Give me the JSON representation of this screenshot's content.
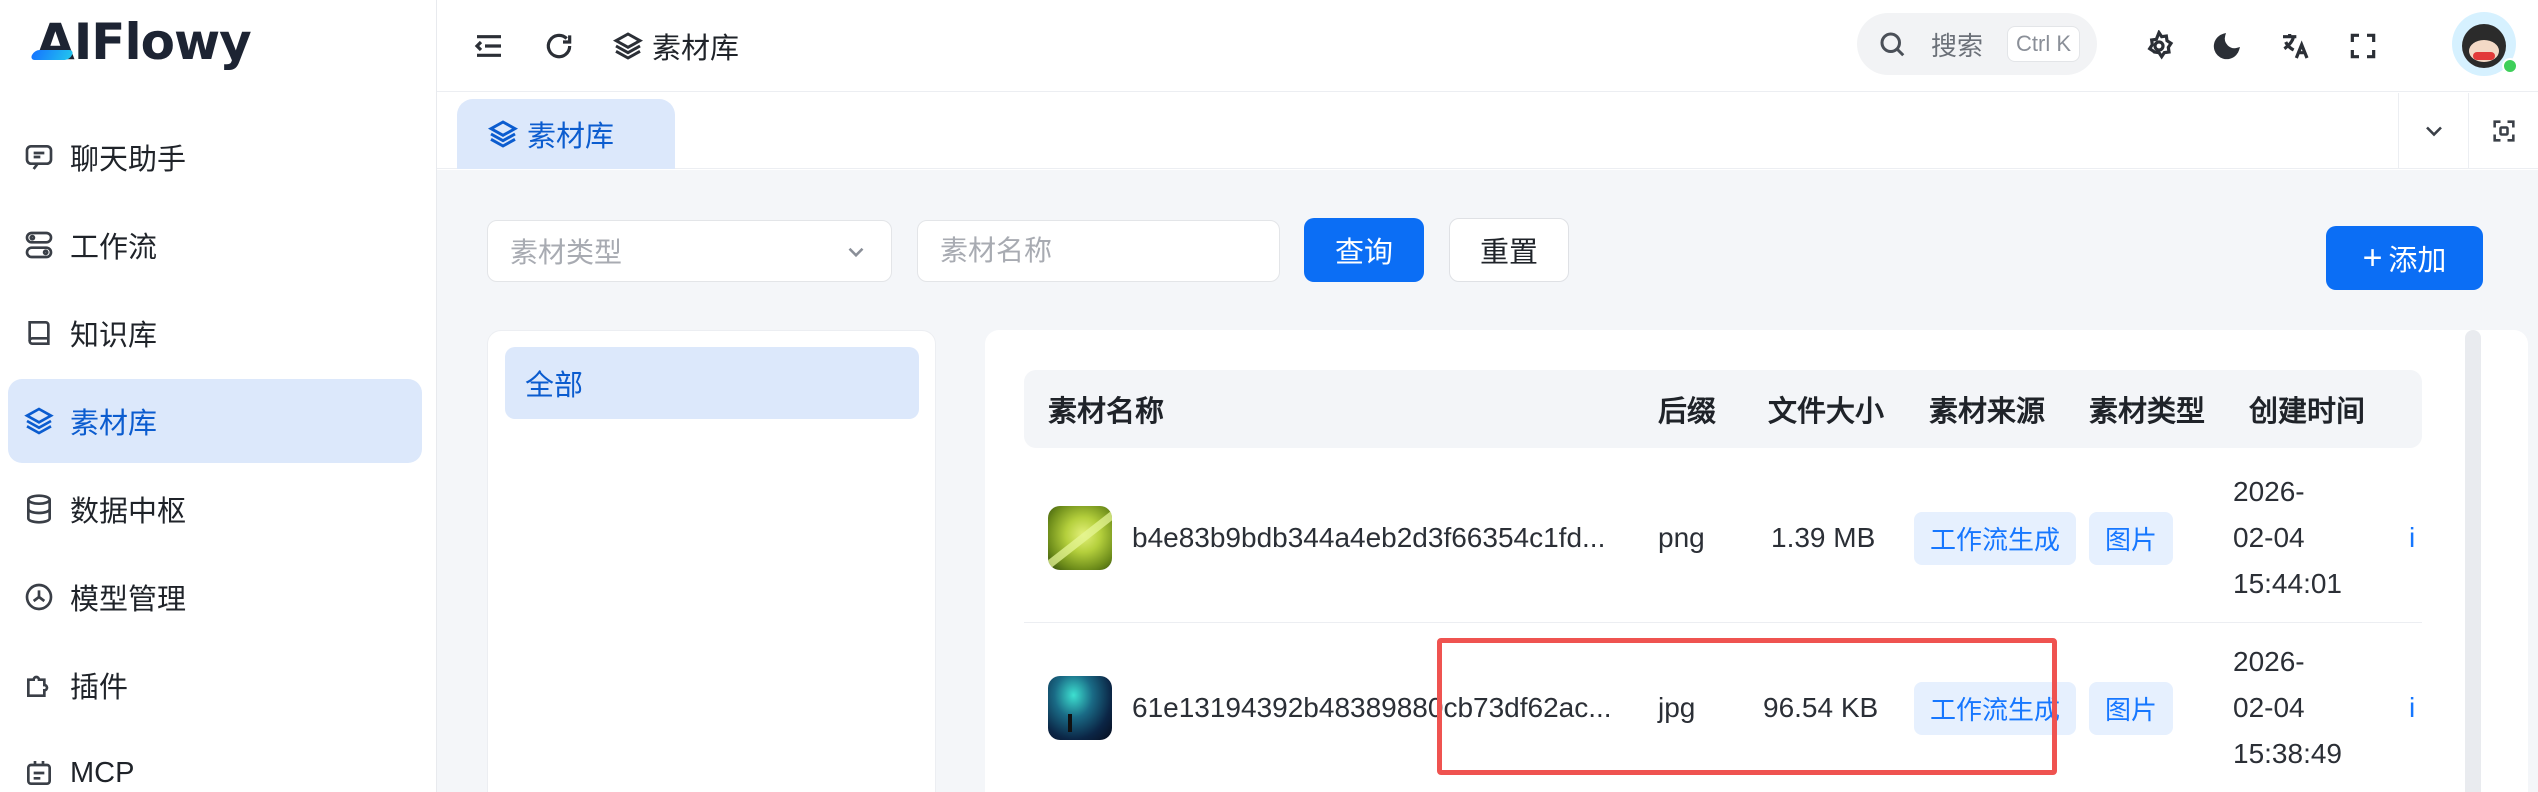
{
  "app": {
    "logo": "AIFlowy"
  },
  "sidebar": {
    "items": [
      {
        "label": "聊天助手",
        "icon": "chat-icon"
      },
      {
        "label": "工作流",
        "icon": "workflow-icon"
      },
      {
        "label": "知识库",
        "icon": "book-icon"
      },
      {
        "label": "素材库",
        "icon": "layers-icon",
        "active": true
      },
      {
        "label": "数据中枢",
        "icon": "database-icon"
      },
      {
        "label": "模型管理",
        "icon": "model-icon"
      },
      {
        "label": "插件",
        "icon": "puzzle-icon"
      },
      {
        "label": "MCP",
        "icon": "mcp-icon"
      }
    ]
  },
  "header": {
    "breadcrumb": "素材库",
    "search_placeholder": "搜索",
    "search_shortcut": "Ctrl K"
  },
  "tabs": {
    "active_label": "素材库"
  },
  "filters": {
    "type_placeholder": "素材类型",
    "name_placeholder": "素材名称",
    "query_label": "查询",
    "reset_label": "重置",
    "add_label": "添加"
  },
  "categories": {
    "items": [
      "全部"
    ]
  },
  "table": {
    "columns": [
      "素材名称",
      "后缀",
      "文件大小",
      "素材来源",
      "素材类型",
      "创建时间"
    ],
    "rows": [
      {
        "name": "b4e83b9bdb344a4eb2d3f66354c1fd...",
        "suffix": "png",
        "size": "1.39 MB",
        "source": "工作流生成",
        "type": "图片",
        "date": "2026-",
        "date2": "02-04",
        "time": "15:44:01",
        "edge": "i"
      },
      {
        "name": "61e13194392b48389880cb73df62ac...",
        "suffix": "jpg",
        "size": "96.54 KB",
        "source": "工作流生成",
        "type": "图片",
        "date": "2026-",
        "date2": "02-04",
        "time": "15:38:49",
        "edge": "i"
      }
    ]
  },
  "colors": {
    "primary": "#0b6ef5",
    "active_bg": "#dce8fb",
    "highlight": "#ef5350"
  }
}
